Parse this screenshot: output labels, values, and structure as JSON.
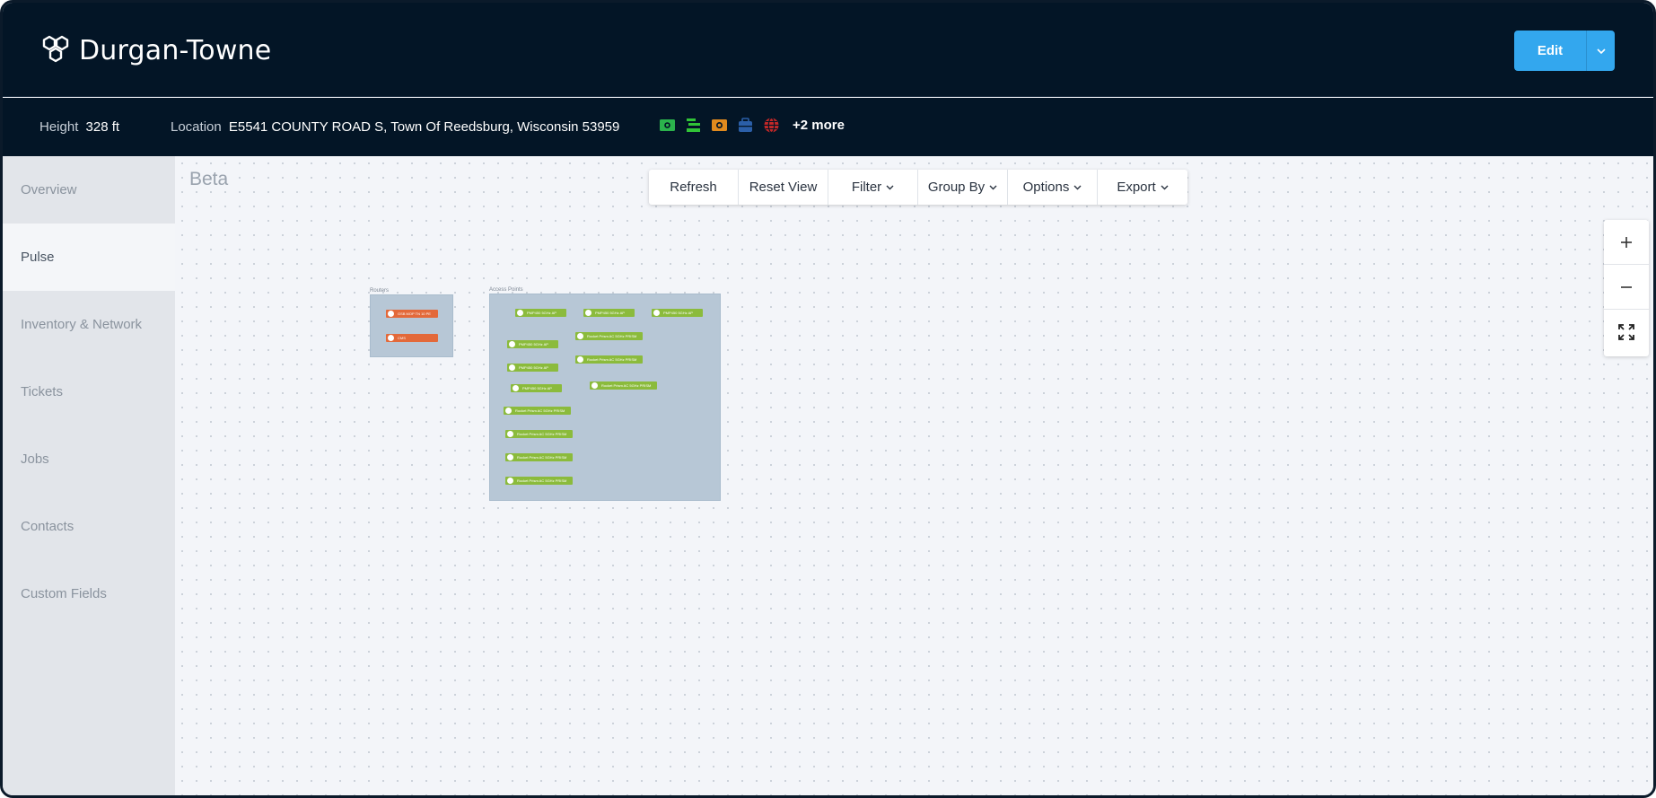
{
  "header": {
    "site_name": "Durgan-Towne",
    "edit_label": "Edit",
    "logo_icon": "hexagon-cluster-icon"
  },
  "info": {
    "height_label": "Height",
    "height_value": "328 ft",
    "location_label": "Location",
    "location_value": "E5541 COUNTY ROAD S, Town Of Reedsburg, Wisconsin 53959",
    "badges": [
      {
        "icon": "money-icon",
        "color": "#2bb24c"
      },
      {
        "icon": "antenna-icon",
        "color": "#31c437"
      },
      {
        "icon": "camera-icon",
        "color": "#e08a1e"
      },
      {
        "icon": "briefcase-icon",
        "color": "#2b5fa8"
      },
      {
        "icon": "globe-icon",
        "color": "#c62828"
      }
    ],
    "more_label": "+2 more"
  },
  "sidebar": {
    "items": [
      {
        "label": "Overview",
        "active": false
      },
      {
        "label": "Pulse",
        "active": true
      },
      {
        "label": "Inventory & Network",
        "active": false
      },
      {
        "label": "Tickets",
        "active": false
      },
      {
        "label": "Jobs",
        "active": false
      },
      {
        "label": "Contacts",
        "active": false
      },
      {
        "label": "Custom Fields",
        "active": false
      }
    ]
  },
  "canvas": {
    "beta_label": "Beta",
    "toolbar": {
      "refresh": "Refresh",
      "reset_view": "Reset View",
      "filter": "Filter",
      "group_by": "Group By",
      "options": "Options",
      "export": "Export"
    },
    "zoom": {
      "in_icon": "plus-icon",
      "out_icon": "minus-icon",
      "fit_icon": "expand-icon"
    },
    "groups": {
      "routers": {
        "label": "Routers",
        "nodes": [
          "GSB MOP TN 10 PE",
          "CMS"
        ]
      },
      "access_points": {
        "label": "Access Points",
        "nodes": [
          "PMP450 5GHz AP",
          "PMP450 5GHz AP",
          "PMP450 5GHz AP",
          "Rocket Prism AC 5GHz PRISM",
          "PMP450 5GHz AP",
          "Rocket Prism AC 5GHz PRISM",
          "PMP450 5GHz AP",
          "Rocket Prism AC 5GHz PRISM",
          "PMP450 5GHz AP",
          "Rocket Prism AC 5GHz PRISM",
          "Rocket Prism AC 5GHz PRISM",
          "Rocket Prism AC 5GHz PRISM",
          "Rocket Prism AC 5GHz PRISM"
        ]
      }
    }
  }
}
